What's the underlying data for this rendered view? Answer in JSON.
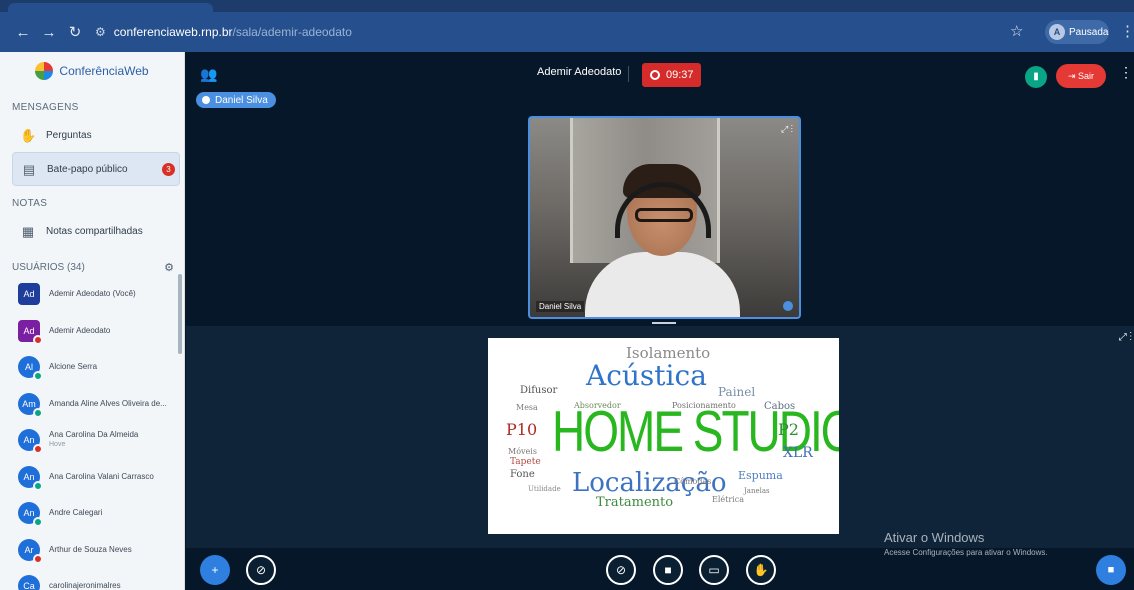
{
  "browser": {
    "url_host": "conferenciaweb.rnp.br",
    "url_path": "/sala/ademir-adeodato",
    "profile_label": "Pausada",
    "profile_initial": "A"
  },
  "sidebar": {
    "brand": "ConferênciaWeb",
    "messages_section": "MENSAGENS",
    "items": [
      {
        "label": "Perguntas",
        "icon": "hand-icon"
      },
      {
        "label": "Bate-papo público",
        "icon": "chat-icon",
        "badge": "3"
      }
    ],
    "notes_section": "NOTAS",
    "notes_item": "Notas compartilhadas",
    "users_section": "USUÁRIOS (34)",
    "users": [
      {
        "initials": "Ad",
        "name": "Ademir Adeodato (Você)",
        "shape": "sq",
        "color": "#1f3d9a",
        "status": ""
      },
      {
        "initials": "Ad",
        "name": "Ademir Adeodato",
        "shape": "sq",
        "color": "#7b1fa2",
        "status": "#d93025"
      },
      {
        "initials": "Al",
        "name": "Alcione Serra",
        "shape": "round",
        "color": "#1e6fd9",
        "status": "#0aa486"
      },
      {
        "initials": "Am",
        "name": "Amanda Aline Alves Oliveira de...",
        "shape": "round",
        "color": "#1e6fd9",
        "status": "#0aa486"
      },
      {
        "initials": "An",
        "name": "Ana Carolina Da Almeida",
        "sub": "Hove",
        "shape": "round",
        "color": "#1e6fd9",
        "status": "#d93025"
      },
      {
        "initials": "An",
        "name": "Ana Carolina Valani Carrasco",
        "shape": "round",
        "color": "#1e6fd9",
        "status": "#0aa486"
      },
      {
        "initials": "An",
        "name": "Andre Calegari",
        "shape": "round",
        "color": "#1e6fd9",
        "status": "#0aa486"
      },
      {
        "initials": "Ar",
        "name": "Arthur de Souza Neves",
        "shape": "round",
        "color": "#1e6fd9",
        "status": "#d93025"
      },
      {
        "initials": "Ca",
        "name": "carolinajeronimalres",
        "shape": "round",
        "color": "#1e6fd9",
        "status": ""
      }
    ]
  },
  "meeting": {
    "title": "Ademir Adeodato",
    "timer": "09:37",
    "exit_label": "Sair",
    "talking": "Daniel Silva",
    "video_name": "Daniel Silva"
  },
  "wordcloud": {
    "words": [
      {
        "t": "HOME STUDIO",
        "c": "#29b71f",
        "s": 46
      },
      {
        "t": "Acústica",
        "c": "#2f74c9",
        "s": 28
      },
      {
        "t": "Localização",
        "c": "#3b73c0",
        "s": 26
      },
      {
        "t": "Isolamento",
        "c": "#8a8a8a",
        "s": 15
      },
      {
        "t": "Painel",
        "c": "#7a8ea6",
        "s": 12
      },
      {
        "t": "P10",
        "c": "#b02a1e",
        "s": 16
      },
      {
        "t": "P2",
        "c": "#2d8d33",
        "s": 16
      },
      {
        "t": "XLR",
        "c": "#3f6db0",
        "s": 14
      },
      {
        "t": "Tratamento",
        "c": "#3f8a3f",
        "s": 13
      },
      {
        "t": "Difusor",
        "c": "#505050",
        "s": 10
      },
      {
        "t": "Espuma",
        "c": "#4c7fc1",
        "s": 11
      },
      {
        "t": "Cabos",
        "c": "#5c6f84",
        "s": 10
      },
      {
        "t": "Tapete",
        "c": "#b44a40",
        "s": 9
      },
      {
        "t": "Fone",
        "c": "#555555",
        "s": 10
      },
      {
        "t": "Móveis",
        "c": "#777777",
        "s": 8
      },
      {
        "t": "Absorvedor",
        "c": "#6a8b5b",
        "s": 8
      },
      {
        "t": "Posicionamento",
        "c": "#6f6f6f",
        "s": 8
      },
      {
        "t": "Elétrica",
        "c": "#7b7b7b",
        "s": 8
      },
      {
        "t": "Janelas",
        "c": "#7a7a7a",
        "s": 7
      },
      {
        "t": "Utilidade",
        "c": "#8a8a8a",
        "s": 7
      },
      {
        "t": "Cômodas",
        "c": "#7a7a7a",
        "s": 8
      },
      {
        "t": "Mesa",
        "c": "#7a7a7a",
        "s": 8
      }
    ]
  },
  "watermark": {
    "line1": "Ativar o Windows",
    "line2": "Acesse Configurações para ativar o Windows."
  }
}
